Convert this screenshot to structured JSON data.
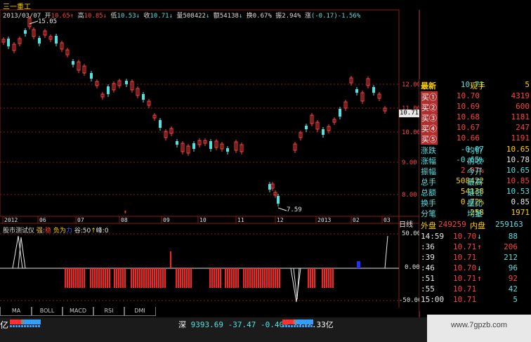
{
  "header": {
    "stock_name": "三一重工",
    "date": "2013/03/07",
    "open_label": "开",
    "open": "10.65",
    "high_label": "高",
    "high": "10.85",
    "low_label": "低",
    "low": "10.53",
    "close_label": "收",
    "close": "10.71",
    "vol_label": "量",
    "vol": "508422",
    "amt_label": "额",
    "amt": "54138",
    "turn_label": "换",
    "turn": "0.67%",
    "amp_label": "振",
    "amp": "2.94%",
    "chg_label": "涨",
    "chg": "(-0.17)-1.56%"
  },
  "price_chart": {
    "ylabels": [
      "12.00",
      "11.00",
      "10.00",
      "9.00",
      "8.00"
    ],
    "current_tag": "10.71",
    "annotations": {
      "high": "15.05",
      "low": "7.59"
    },
    "xlabels": [
      "2012",
      "06",
      "07",
      "08",
      "09",
      "10",
      "11",
      "12",
      "2013",
      "02",
      "03"
    ],
    "period": "日线"
  },
  "indicator": {
    "name": "股市测试仪",
    "strong_label": "强:",
    "strong_val": "稳",
    "weak": "负为",
    "weak_val": "力",
    "valley_label": "谷:",
    "valley_val": "50",
    "peak_label": "峰:",
    "peak_val": "0",
    "ylabels": [
      "50.00",
      "0.00",
      "-50.00"
    ]
  },
  "quote": {
    "latest_label": "最新",
    "latest": "10.71",
    "now_hand_label": "现手",
    "now_hand": "5",
    "bids": [
      {
        "label": "买①",
        "price": "10.70",
        "vol": "4319"
      },
      {
        "label": "买②",
        "price": "10.69",
        "vol": "600"
      },
      {
        "label": "买③",
        "price": "10.68",
        "vol": "1181"
      },
      {
        "label": "买④",
        "price": "10.67",
        "vol": "247"
      },
      {
        "label": "买⑤",
        "price": "10.66",
        "vol": "1191"
      }
    ],
    "stats": [
      {
        "l1": "涨跌",
        "v1": "-0.07",
        "l2": "均价",
        "v2": "10.65"
      },
      {
        "l1": "涨幅",
        "v1": "-0.65%",
        "l2": "前收",
        "v2": "10.78"
      },
      {
        "l1": "振幅",
        "v1": "2.97%",
        "l2": "今开",
        "v2": "10.65"
      },
      {
        "l1": "总手",
        "v1": "508422",
        "l2": "最高",
        "v2": "10.85"
      },
      {
        "l1": "总额",
        "v1": "54138",
        "l2": "最低",
        "v2": "10.53"
      },
      {
        "l1": "换手",
        "v1": "0.72%",
        "l2": "量比",
        "v2": "0.85"
      },
      {
        "l1": "分笔",
        "v1": "258",
        "l2": "均量",
        "v2": "1971"
      }
    ],
    "outer_label": "外盘",
    "outer": "249259",
    "inner_label": "内盘",
    "inner": "259163",
    "ticks": [
      {
        "time": "14:59",
        "price": "10.70",
        "dir": "↓",
        "vol": "88"
      },
      {
        "time": ":36",
        "price": "10.71",
        "dir": "↑",
        "vol": "206"
      },
      {
        "time": ":39",
        "price": "10.71",
        "dir": "",
        "vol": "212"
      },
      {
        "time": ":46",
        "price": "10.70",
        "dir": "↓",
        "vol": "96"
      },
      {
        "time": ":51",
        "price": "10.71",
        "dir": "↑",
        "vol": "92"
      },
      {
        "time": ":55",
        "price": "10.71",
        "dir": "",
        "vol": "42"
      },
      {
        "time": "15:00",
        "price": "10.71",
        "dir": "",
        "vol": "5"
      }
    ]
  },
  "tabs": [
    "MA",
    "BOLL",
    "MACD",
    "RSI",
    "DMI"
  ],
  "statusbar": {
    "left": "亿",
    "index_label": "深",
    "index_value": "9393.69",
    "index_change": "-37.47",
    "index_pct": "-0.40%",
    "index_amount": "1257.33亿"
  },
  "watermark": "www.7gpzb.com",
  "colors": {
    "up": "#ff4040",
    "down": "#54e0e0",
    "grid": "#8b1a1a",
    "label": "#ffd000"
  }
}
